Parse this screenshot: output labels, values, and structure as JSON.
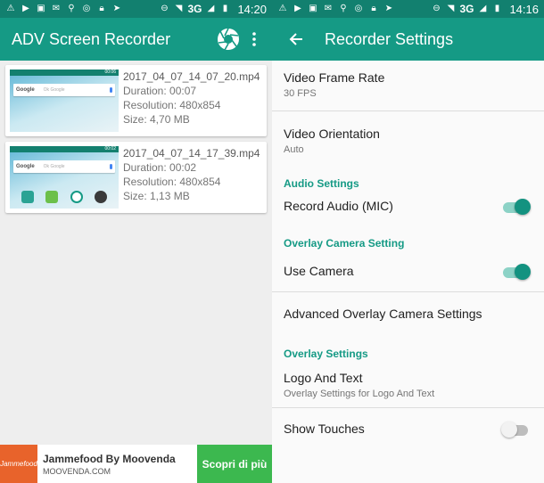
{
  "statusbar_left": {
    "network": "3G",
    "time": "14:20"
  },
  "statusbar_right": {
    "network": "3G",
    "time": "14:16"
  },
  "recorder": {
    "title": "ADV Screen Recorder",
    "recordings": [
      {
        "filename": "2017_04_07_14_07_20.mp4",
        "duration": "Duration: 00:07",
        "resolution": "Resolution: 480x854",
        "size": "Size: 4,70 MB",
        "thumb_time": "00:06",
        "thumb_search": "Google",
        "thumb_hint": "Ok Google"
      },
      {
        "filename": "2017_04_07_14_17_39.mp4",
        "duration": "Duration: 00:02",
        "resolution": "Resolution: 480x854",
        "size": "Size: 1,13 MB",
        "thumb_time": "00:02",
        "thumb_search": "Google",
        "thumb_hint": "Ok Google"
      }
    ],
    "ad": {
      "logo": "Jammefood",
      "name": "Jammefood By Moovenda",
      "domain": "MOOVENDA.COM",
      "cta": "Scopri di più"
    }
  },
  "settings": {
    "title": "Recorder Settings",
    "frame_rate": {
      "title": "Video Frame Rate",
      "value": "30 FPS"
    },
    "orientation": {
      "title": "Video Orientation",
      "value": "Auto"
    },
    "audio_category": "Audio Settings",
    "record_audio": {
      "title": "Record Audio (MIC)",
      "enabled": true
    },
    "camera_category": "Overlay Camera Setting",
    "use_camera": {
      "title": "Use Camera",
      "enabled": true
    },
    "advanced_camera": {
      "title": "Advanced Overlay Camera Settings"
    },
    "overlay_category": "Overlay Settings",
    "logo_text": {
      "title": "Logo And Text",
      "summary": "Overlay Settings for Logo And Text"
    },
    "show_touches": {
      "title": "Show Touches",
      "enabled": false
    }
  },
  "colors": {
    "accent": "#159a85",
    "statusbar": "#12806f",
    "ad_cta": "#3cb84f"
  }
}
